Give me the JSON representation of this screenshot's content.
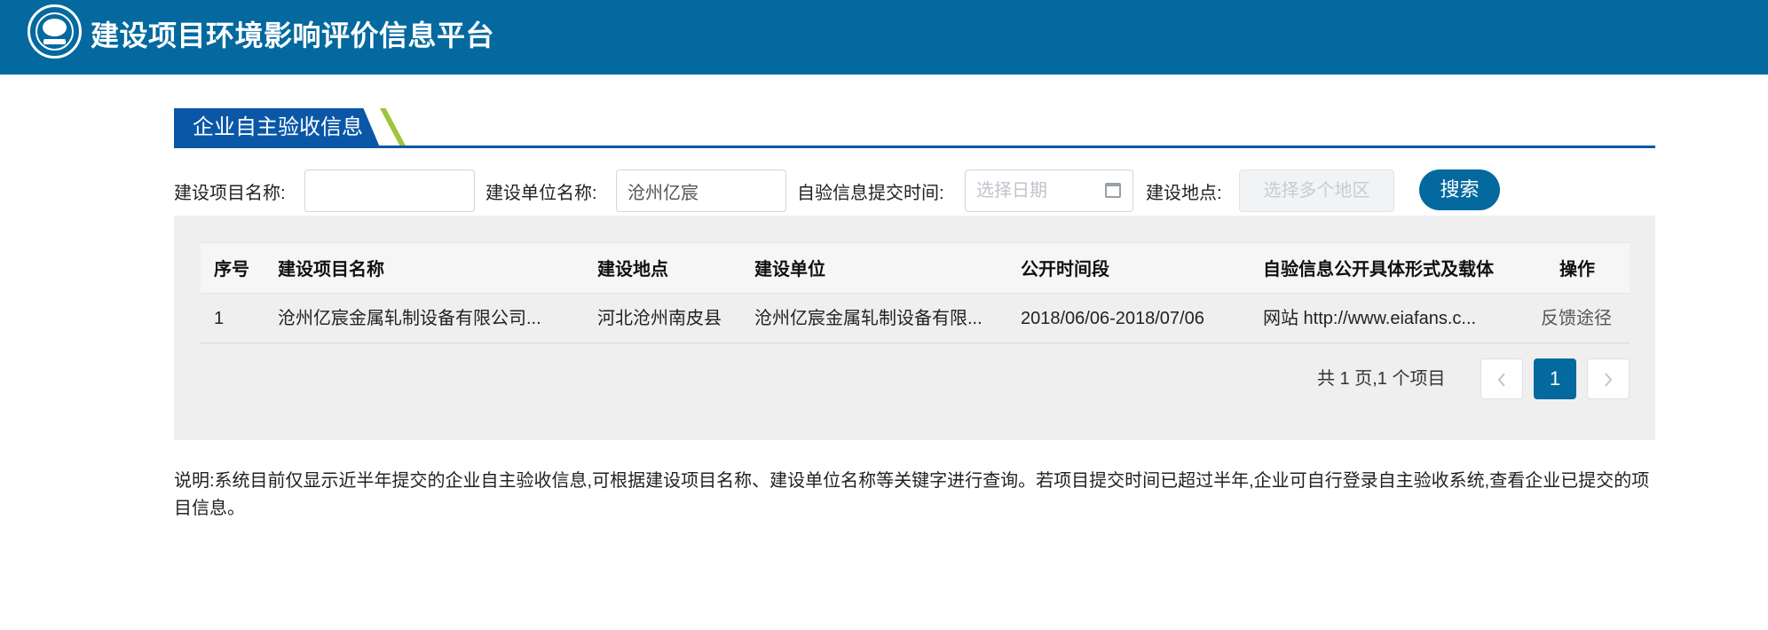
{
  "header": {
    "title": "建设项目环境影响评价信息平台",
    "logo_icon": "mee-logo-icon",
    "bg_color": "#03699f"
  },
  "section": {
    "title": "企业自主验收信息",
    "tab_color": "#0a57a7",
    "stripe_color": "#9dc53b"
  },
  "filters": {
    "project_name_label": "建设项目名称:",
    "project_name_value": "",
    "unit_name_label": "建设单位名称:",
    "unit_name_value": "沧州亿宸",
    "submit_time_label": "自验信息提交时间:",
    "submit_time_placeholder": "选择日期",
    "location_label": "建设地点:",
    "location_placeholder": "选择多个地区",
    "search_label": "搜索"
  },
  "table": {
    "headers": [
      "序号",
      "建设项目名称",
      "建设地点",
      "建设单位",
      "公开时间段",
      "自验信息公开具体形式及载体",
      "操作"
    ],
    "rows": [
      {
        "index": "1",
        "project": "沧州亿宸金属轧制设备有限公司...",
        "location": "河北沧州南皮县",
        "unit": "沧州亿宸金属轧制设备有限...",
        "period": "2018/06/06-2018/07/06",
        "carrier": "网站 http://www.eiafans.c...",
        "action": "反馈途径"
      }
    ]
  },
  "pager": {
    "summary": "共 1 页,1 个项目",
    "prev_icon": "chevron-left-icon",
    "current_page": "1",
    "next_icon": "chevron-right-icon"
  },
  "note": "说明:系统目前仅显示近半年提交的企业自主验收信息,可根据建设项目名称、建设单位名称等关键字进行查询。若项目提交时间已超过半年,企业可自行登录自主验收系统,查看企业已提交的项目信息。"
}
